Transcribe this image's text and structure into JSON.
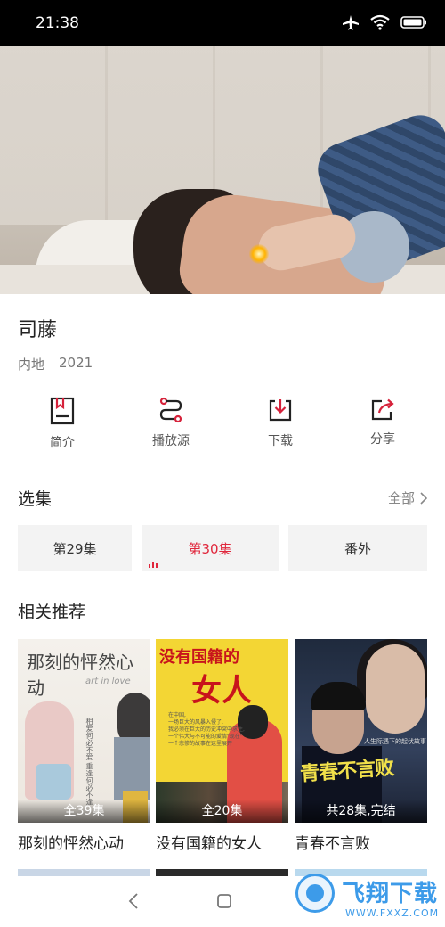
{
  "status_bar": {
    "time": "21:38",
    "icons": [
      "airplane-icon",
      "wifi-icon",
      "battery-icon"
    ]
  },
  "show": {
    "title": "司藤",
    "region": "内地",
    "year": "2021"
  },
  "actions": [
    {
      "icon": "intro-icon",
      "label": "简介"
    },
    {
      "icon": "source-icon",
      "label": "播放源"
    },
    {
      "icon": "download-icon",
      "label": "下载"
    },
    {
      "icon": "share-icon",
      "label": "分享"
    }
  ],
  "episodes_section": {
    "title": "选集",
    "see_all": "全部"
  },
  "episodes": [
    {
      "label": "第29集",
      "active": false
    },
    {
      "label": "第30集",
      "active": true
    },
    {
      "label": "番外",
      "active": false
    }
  ],
  "recommend_section": {
    "title": "相关推荐"
  },
  "recommendations": [
    {
      "name": "那刻的怦然心动",
      "badge": "全39集",
      "poster_title": "那刻的怦然心动",
      "poster_sub": "art in love",
      "poster_vtext": "相爱何必不爱 重逢何必不逢"
    },
    {
      "name": "没有国籍的女人",
      "badge": "全20集",
      "poster_title": "没有国籍的",
      "poster_big": "女人",
      "poster_text": "在中国,\n一场巨大的风暴入侵了,\n我必须在巨大的历史冲突中求生,\n一个伟大与不可能的爱情\"现在\"\n一个悲惨的故事在这里展开"
    },
    {
      "name": "青春不言败",
      "badge": "共28集,完结",
      "poster_title": "青春不言败",
      "poster_tag": "人生际遇下的起伏故事"
    }
  ],
  "watermark": {
    "text": "飞翔下载",
    "url": "WWW.FXXZ.COM"
  },
  "colors": {
    "accent": "#e0273c",
    "watermark": "#3d9be9"
  }
}
